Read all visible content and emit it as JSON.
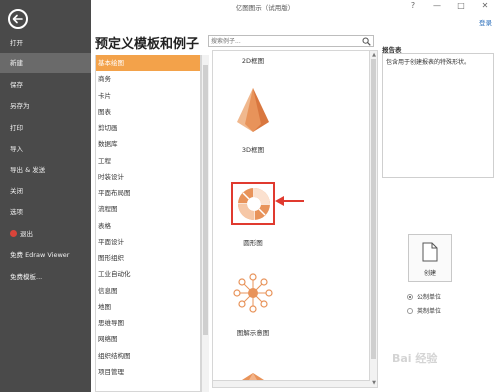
{
  "window": {
    "title": "亿图图示（试用版）",
    "login_link": "登录",
    "controls": [
      "?",
      "—",
      "□",
      "✕"
    ]
  },
  "sidebar": {
    "items": [
      {
        "label": "打开",
        "active": false
      },
      {
        "label": "新建",
        "active": true
      },
      {
        "label": "保存",
        "active": false
      },
      {
        "label": "另存为",
        "active": false
      },
      {
        "label": "打印",
        "active": false
      },
      {
        "label": "导入",
        "active": false
      },
      {
        "label": "导出 & 发送",
        "active": false
      },
      {
        "label": "关闭",
        "active": false
      },
      {
        "label": "选项",
        "active": false
      },
      {
        "label": "退出",
        "active": false
      },
      {
        "label": "免费 Edraw Viewer",
        "active": false
      },
      {
        "label": "免费模板...",
        "active": false
      }
    ]
  },
  "main": {
    "title": "预定义模板和例子",
    "search": {
      "placeholder": "搜索例子..."
    },
    "categories": [
      "基本绘图",
      "商务",
      "卡片",
      "图表",
      "剪切画",
      "数据库",
      "工程",
      "时装设计",
      "平面布局图",
      "流程图",
      "表格",
      "平面设计",
      "图形组织",
      "工业自动化",
      "信息图",
      "地图",
      "思维导图",
      "网络图",
      "组织结构图",
      "项目管理"
    ],
    "selected_category": "基本绘图",
    "templates": [
      {
        "label": "2D框图",
        "icon": "2d-block-icon"
      },
      {
        "label": "3D框图",
        "icon": "3d-pyramid-icon"
      },
      {
        "label": "圆形图",
        "icon": "circular-diagram-icon",
        "selected": true
      },
      {
        "label": "图解示意图",
        "icon": "illustration-diagram-icon"
      }
    ]
  },
  "details": {
    "title": "报告表",
    "description": "包含用于创建报表的特殊形状。",
    "create_label": "创建",
    "units": [
      {
        "label": "公制单位",
        "checked": true
      },
      {
        "label": "英制单位",
        "checked": false
      }
    ]
  },
  "watermark": "Bai 经验",
  "colors": {
    "sidebar_bg": "#4a4a4a",
    "selected_category": "#f3a24a",
    "accent_orange": "#e8935a",
    "highlight_red": "#e03a2f",
    "link_blue": "#2a6ebb"
  }
}
